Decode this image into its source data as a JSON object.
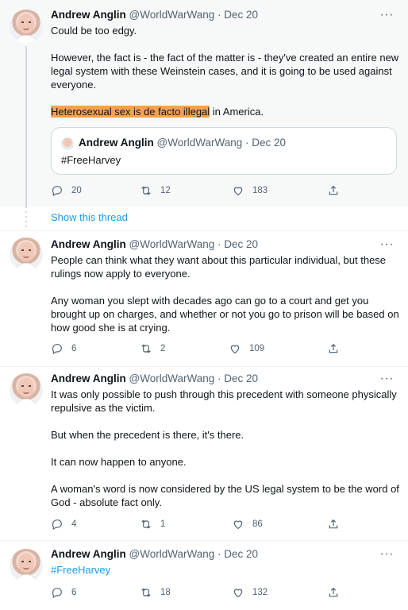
{
  "tweets": [
    {
      "name": "Andrew Anglin",
      "meta": "@WorldWarWang · Dec 20",
      "more": "···",
      "text": {
        "p1": "Could be too edgy.",
        "p2": "However, the fact is - the fact of the matter is - they've created an entire new legal system with these Weinstein cases, and it is going to be used against everyone.",
        "p3_highlight": "Heterosexual sex is de facto illegal",
        "p3_rest": " in America."
      },
      "quote": {
        "name": "Andrew Anglin",
        "meta": "@WorldWarWang · Dec 20",
        "text": "#FreeHarvey"
      },
      "actions": {
        "replies": "20",
        "retweets": "12",
        "likes": "183"
      }
    },
    {
      "show_thread": "Show this thread"
    },
    {
      "name": "Andrew Anglin",
      "meta": "@WorldWarWang · Dec 20",
      "more": "···",
      "text": {
        "p1": "People can think what they want about this particular individual, but these rulings now apply to everyone.",
        "p2": "Any woman you slept with decades ago can go to a court and get you brought up on charges, and whether or not you go to prison will be based on how good she is at crying."
      },
      "actions": {
        "replies": "6",
        "retweets": "2",
        "likes": "109"
      }
    },
    {
      "name": "Andrew Anglin",
      "meta": "@WorldWarWang · Dec 20",
      "more": "···",
      "text": {
        "p1": "It was only possible to push through this precedent with someone physically repulsive as the victim.",
        "p2": "But when the precedent is there, it's there.",
        "p3": "It can now happen to anyone.",
        "p4": "A woman's word is now considered by the US legal system to be the word of God - absolute fact only."
      },
      "actions": {
        "replies": "4",
        "retweets": "1",
        "likes": "86"
      }
    },
    {
      "name": "Andrew Anglin",
      "meta": "@WorldWarWang · Dec 20",
      "more": "···",
      "text": {
        "p1": "#FreeHarvey"
      },
      "actions": {
        "replies": "6",
        "retweets": "18",
        "likes": "132"
      }
    }
  ],
  "icons": {
    "reply": "reply-icon",
    "retweet": "retweet-icon",
    "like": "heart-icon",
    "share": "share-icon"
  },
  "colors": {
    "link": "#1d9bf0",
    "highlight": "#f7a24b",
    "muted": "#536471"
  }
}
